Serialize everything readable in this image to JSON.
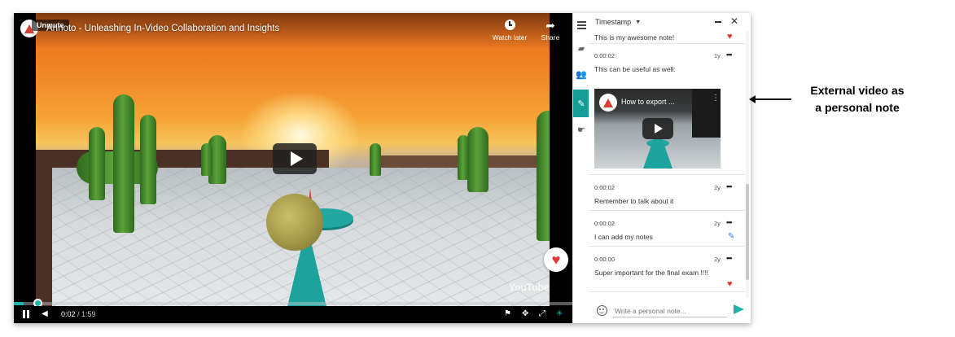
{
  "video": {
    "title": "Annoto - Unleashing In-Video Collaboration and Insights",
    "unmute_label": "Unmute",
    "watch_later_label": "Watch later",
    "share_label": "Share",
    "watermark": "YouTube",
    "current_time": "0:02",
    "duration": "/ 1:59",
    "progress_fraction": 0.017
  },
  "panel": {
    "sort_label": "Timestamp",
    "input_placeholder": "Write a personal note...",
    "notes": [
      {
        "timestamp": "",
        "age": "",
        "text": "This is my awesome note!",
        "icon": "heart-icon"
      },
      {
        "timestamp": "0:00:02",
        "age": "1y",
        "text": "This can be useful as well:",
        "embed_title": "How to export ..."
      },
      {
        "timestamp": "0:00:02",
        "age": "2y",
        "text": "Remember to talk about it"
      },
      {
        "timestamp": "0:00:02",
        "age": "2y",
        "text": "I can add my notes",
        "icon": "pencil-icon"
      },
      {
        "timestamp": "0:00:00",
        "age": "2y",
        "text": "Super important for the final exam !!!!",
        "icon": "heart-icon"
      }
    ]
  },
  "annotation": {
    "line1": "External video as",
    "line2": "a personal note"
  },
  "colors": {
    "accent": "#1fb5ad",
    "heart": "#e53935",
    "pencil": "#2f86d8"
  }
}
